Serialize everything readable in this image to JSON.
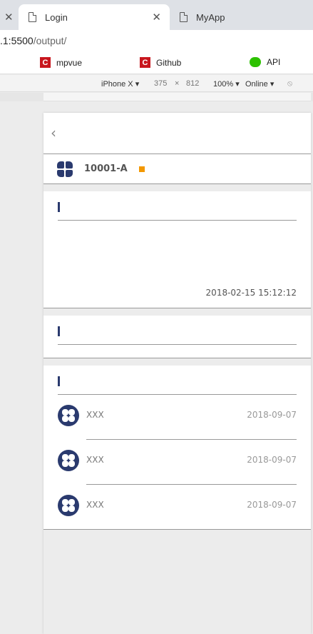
{
  "browser": {
    "tabs": [
      {
        "label": "Login"
      },
      {
        "label": "MyApp"
      }
    ],
    "url_host": ".1:5500",
    "url_path": "/output/",
    "bookmarks": [
      {
        "label": "mpvue"
      },
      {
        "label": "Github"
      },
      {
        "label": "API"
      }
    ],
    "device": "iPhone X",
    "width": "375",
    "height": "812",
    "zoom": "100%",
    "network": "Online"
  },
  "page": {
    "title": "",
    "back_icon": "chevron-left-icon"
  },
  "project": {
    "label": "",
    "value": "10001-A",
    "tag": ""
  },
  "info": {
    "title": "",
    "status": "",
    "rows": [
      {
        "key": "",
        "value": ""
      },
      {
        "key": "",
        "value": ""
      },
      {
        "key": "",
        "value": ""
      },
      {
        "key": "",
        "value": "2018-02-15 15:12:12"
      }
    ]
  },
  "description": {
    "title": "",
    "text": ""
  },
  "comments": {
    "title": "",
    "items": [
      {
        "name": "XXX",
        "date": "2018-09-07",
        "text": ""
      },
      {
        "name": "XXX",
        "date": "2018-09-07",
        "text": ""
      },
      {
        "name": "XXX",
        "date": "2018-09-07",
        "text": ""
      }
    ]
  },
  "colors": {
    "accent": "#2a3a6e",
    "tag": "#f39800",
    "unresolved": "#e60012",
    "urgent": "#f39800"
  }
}
